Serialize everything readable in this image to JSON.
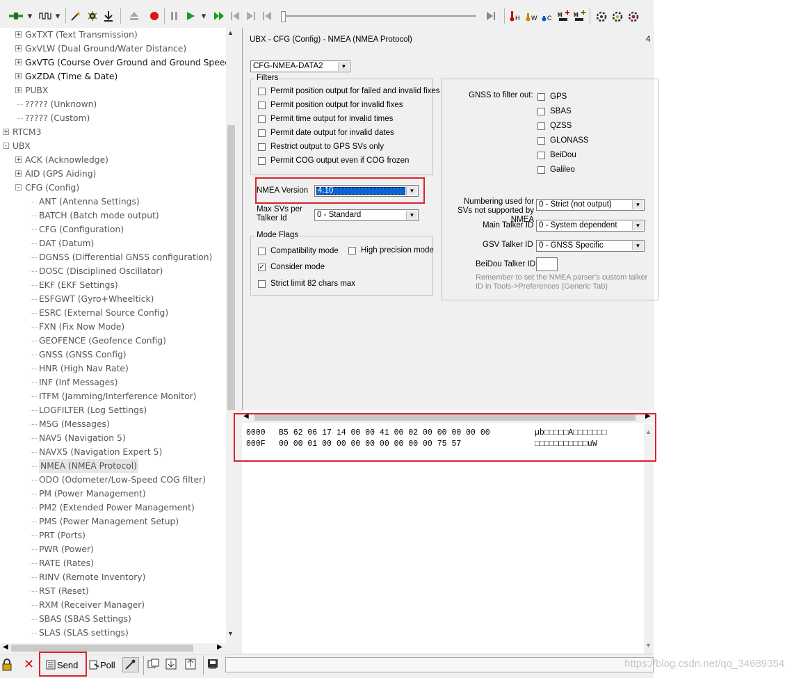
{
  "tree": {
    "items": [
      {
        "label": "GxTXT (Text Transmission)",
        "level": 1,
        "expander": "+",
        "style": ""
      },
      {
        "label": "GxVLW (Dual Ground/Water Distance)",
        "level": 1,
        "expander": "+",
        "style": ""
      },
      {
        "label": "GxVTG (Course Over Ground and Ground Speed)",
        "level": 1,
        "expander": "+",
        "style": "dark"
      },
      {
        "label": "GxZDA (Time & Date)",
        "level": 1,
        "expander": "+",
        "style": "dark"
      },
      {
        "label": "PUBX",
        "level": 1,
        "expander": "+",
        "style": ""
      },
      {
        "label": "????? (Unknown)",
        "level": 1,
        "expander": "",
        "style": ""
      },
      {
        "label": "????? (Custom)",
        "level": 1,
        "expander": "",
        "style": ""
      },
      {
        "label": "RTCM3",
        "level": 0,
        "expander": "+",
        "style": ""
      },
      {
        "label": "UBX",
        "level": 0,
        "expander": "-",
        "style": ""
      },
      {
        "label": "ACK (Acknowledge)",
        "level": 1,
        "expander": "+",
        "style": ""
      },
      {
        "label": "AID (GPS Aiding)",
        "level": 1,
        "expander": "+",
        "style": ""
      },
      {
        "label": "CFG (Config)",
        "level": 1,
        "expander": "-",
        "style": ""
      },
      {
        "label": "ANT (Antenna Settings)",
        "level": 2,
        "expander": "",
        "style": ""
      },
      {
        "label": "BATCH (Batch mode output)",
        "level": 2,
        "expander": "",
        "style": ""
      },
      {
        "label": "CFG (Configuration)",
        "level": 2,
        "expander": "",
        "style": ""
      },
      {
        "label": "DAT (Datum)",
        "level": 2,
        "expander": "",
        "style": ""
      },
      {
        "label": "DGNSS (Differential GNSS configuration)",
        "level": 2,
        "expander": "",
        "style": ""
      },
      {
        "label": "DOSC (Disciplined Oscillator)",
        "level": 2,
        "expander": "",
        "style": ""
      },
      {
        "label": "EKF (EKF Settings)",
        "level": 2,
        "expander": "",
        "style": ""
      },
      {
        "label": "ESFGWT (Gyro+Wheeltick)",
        "level": 2,
        "expander": "",
        "style": ""
      },
      {
        "label": "ESRC (External Source Config)",
        "level": 2,
        "expander": "",
        "style": ""
      },
      {
        "label": "FXN (Fix Now Mode)",
        "level": 2,
        "expander": "",
        "style": ""
      },
      {
        "label": "GEOFENCE (Geofence Config)",
        "level": 2,
        "expander": "",
        "style": ""
      },
      {
        "label": "GNSS (GNSS Config)",
        "level": 2,
        "expander": "",
        "style": ""
      },
      {
        "label": "HNR (High Nav Rate)",
        "level": 2,
        "expander": "",
        "style": ""
      },
      {
        "label": "INF (Inf Messages)",
        "level": 2,
        "expander": "",
        "style": ""
      },
      {
        "label": "ITFM (Jamming/Interference Monitor)",
        "level": 2,
        "expander": "",
        "style": ""
      },
      {
        "label": "LOGFILTER (Log Settings)",
        "level": 2,
        "expander": "",
        "style": ""
      },
      {
        "label": "MSG (Messages)",
        "level": 2,
        "expander": "",
        "style": ""
      },
      {
        "label": "NAV5 (Navigation 5)",
        "level": 2,
        "expander": "",
        "style": ""
      },
      {
        "label": "NAVX5 (Navigation Expert 5)",
        "level": 2,
        "expander": "",
        "style": ""
      },
      {
        "label": "NMEA (NMEA Protocol)",
        "level": 2,
        "expander": "",
        "style": "selected"
      },
      {
        "label": "ODO (Odometer/Low-Speed COG filter)",
        "level": 2,
        "expander": "",
        "style": ""
      },
      {
        "label": "PM (Power Management)",
        "level": 2,
        "expander": "",
        "style": ""
      },
      {
        "label": "PM2 (Extended Power Management)",
        "level": 2,
        "expander": "",
        "style": ""
      },
      {
        "label": "PMS (Power Management Setup)",
        "level": 2,
        "expander": "",
        "style": ""
      },
      {
        "label": "PRT (Ports)",
        "level": 2,
        "expander": "",
        "style": ""
      },
      {
        "label": "PWR (Power)",
        "level": 2,
        "expander": "",
        "style": ""
      },
      {
        "label": "RATE (Rates)",
        "level": 2,
        "expander": "",
        "style": ""
      },
      {
        "label": "RINV (Remote Inventory)",
        "level": 2,
        "expander": "",
        "style": ""
      },
      {
        "label": "RST (Reset)",
        "level": 2,
        "expander": "",
        "style": ""
      },
      {
        "label": "RXM (Receiver Manager)",
        "level": 2,
        "expander": "",
        "style": ""
      },
      {
        "label": "SBAS (SBAS Settings)",
        "level": 2,
        "expander": "",
        "style": ""
      },
      {
        "label": "SLAS (SLAS settings)",
        "level": 2,
        "expander": "",
        "style": ""
      }
    ]
  },
  "panel": {
    "title": "UBX - CFG (Config) - NMEA (NMEA Protocol)",
    "page_marker": "4",
    "data_select": "CFG-NMEA-DATA2",
    "filters_title": "Filters",
    "filters": [
      {
        "label": "Permit position output for failed and invalid fixes",
        "checked": false
      },
      {
        "label": "Permit position output for invalid fixes",
        "checked": false
      },
      {
        "label": "Permit time output for invalid times",
        "checked": false
      },
      {
        "label": "Permit date output for invalid dates",
        "checked": false
      },
      {
        "label": "Restrict output to GPS SVs only",
        "checked": false
      },
      {
        "label": "Permit COG output even if COG frozen",
        "checked": false
      }
    ],
    "nmea_version_label": "NMEA Version",
    "nmea_version_value": "4.10",
    "max_svs_label": "Max SVs per Talker Id",
    "max_svs_value": "0 - Standard",
    "mode_flags_title": "Mode Flags",
    "mode_flags": {
      "compat": {
        "label": "Compatibility mode",
        "checked": false
      },
      "highprec": {
        "label": "High precision mode",
        "checked": false
      },
      "consider": {
        "label": "Consider mode",
        "checked": true
      },
      "strict": {
        "label": "Strict limit 82 chars max",
        "checked": false
      }
    },
    "gnss_filter_label": "GNSS to filter out:",
    "gnss_filters": [
      {
        "label": "GPS",
        "checked": false
      },
      {
        "label": "SBAS",
        "checked": false
      },
      {
        "label": "QZSS",
        "checked": false
      },
      {
        "label": "GLONASS",
        "checked": false
      },
      {
        "label": "BeiDou",
        "checked": false
      },
      {
        "label": "Galileo",
        "checked": false
      }
    ],
    "numbering_label": "Numbering used for SVs not supported by NMEA",
    "numbering_value": "0 - Strict (not output)",
    "main_talker_label": "Main Talker ID",
    "main_talker_value": "0 - System dependent",
    "gsv_talker_label": "GSV Talker ID",
    "gsv_talker_value": "0 - GNSS Specific",
    "beidou_talker_label": "BeiDou Talker ID",
    "beidou_talker_value": "",
    "note": "Remember to set the NMEA parser's custom talker ID in Tools->Preferences (Generic Tab)"
  },
  "hex": {
    "lines": [
      {
        "offset": "0000",
        "bytes": "B5 62 06 17 14 00 00 41 00 02 00 00 00 00 00",
        "ascii": "µb□□□□□A□□□□□□□"
      },
      {
        "offset": "000F",
        "bytes": "00 00 01 00 00 00 00 00 00 00 00 75 57",
        "ascii": "□□□□□□□□□□□uW"
      }
    ]
  },
  "statusbar": {
    "send_label": "Send",
    "poll_label": "Poll"
  },
  "watermark": "https://blog.csdn.net/qq_34689354",
  "colors": {
    "highlight_red": "#d9232e",
    "selection_blue": "#0a64d6"
  }
}
